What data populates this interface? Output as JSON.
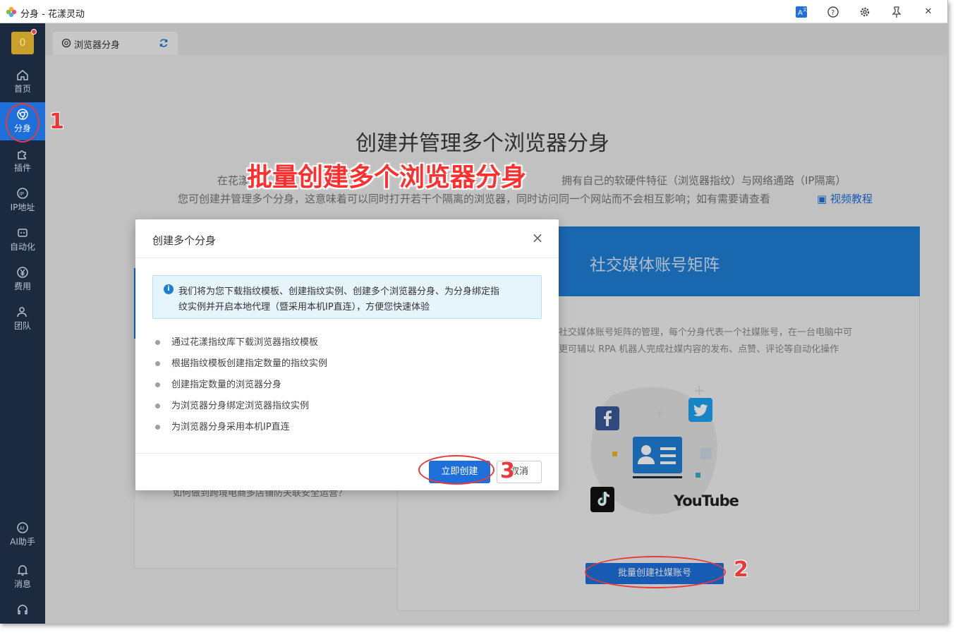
{
  "window": {
    "title": "分身 - 花漾灵动"
  },
  "titlebar": {
    "icons": [
      "translate-icon",
      "help-icon",
      "gear-icon",
      "pin-icon",
      "close-icon"
    ],
    "close_symbol": "✕"
  },
  "sidebar": {
    "avatar": "0",
    "items": [
      {
        "label": "首页",
        "icon": "home-icon"
      },
      {
        "label": "分身",
        "icon": "browser-icon"
      },
      {
        "label": "插件",
        "icon": "plugin-icon"
      },
      {
        "label": "IP地址",
        "icon": "ip-icon"
      },
      {
        "label": "自动化",
        "icon": "robot-icon"
      },
      {
        "label": "费用",
        "icon": "yen-icon"
      },
      {
        "label": "团队",
        "icon": "team-icon"
      },
      {
        "label": "AI助手",
        "icon": "ai-icon"
      },
      {
        "label": "消息",
        "icon": "bell-icon"
      }
    ]
  },
  "tab": {
    "label": "浏览器分身"
  },
  "hero": {
    "title": "创建并管理多个浏览器分身",
    "promo": "批量创建多个浏览器分身",
    "desc1_start": "在花漾",
    "desc1_end": "拥有自己的软硬件特征（浏览器指纹）与网络通路（IP隔离）",
    "desc2": "您可创建并管理多个分身，这意味着可以同时打开若干个隔离的浏览器，同时访问同一个网站而不会相互影响；如有需要请查看",
    "video_link": "视频教程"
  },
  "card_left": {
    "text": "如何做到跨境电商多店铺防关联安全运营？"
  },
  "card_right": {
    "title": "社交媒体账号矩阵",
    "desc1": "社交媒体账号矩阵的管理，每个分身代表一个社媒账号，在一台电脑中可",
    "desc2": "更可辅以 RPA 机器人完成社媒内容的发布、点赞、评论等自动化操作",
    "button": "批量创建社媒账号",
    "brand_youtube": "YouTube",
    "brand_colors": {
      "facebook": "#3b5998",
      "twitter": "#1da1f2",
      "youtube": "#e62117",
      "tiktok": "#111111"
    }
  },
  "dialog": {
    "title": "创建多个分身",
    "info_line1": "我们将为您下载指纹模板、创建指纹实例、创建多个浏览器分身、为分身绑定指",
    "info_line2": "纹实例并开启本地代理（暨采用本机IP直连），方便您快速体验",
    "steps": [
      "通过花漾指纹库下载浏览器指纹模板",
      "根据指纹模板创建指定数量的指纹实例",
      "创建指定数量的浏览器分身",
      "为浏览器分身绑定浏览器指纹实例",
      "为浏览器分身采用本机IP直连"
    ],
    "confirm": "立即创建",
    "cancel": "取消"
  },
  "annotations": {
    "n1": "1",
    "n2": "2",
    "n3": "3"
  }
}
